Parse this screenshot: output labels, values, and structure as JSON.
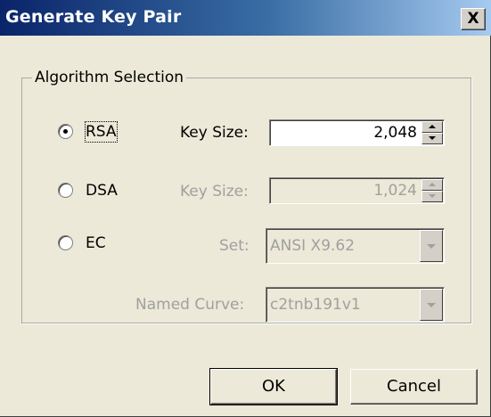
{
  "window": {
    "title": "Generate Key Pair",
    "close_glyph": "X"
  },
  "group": {
    "legend": "Algorithm Selection"
  },
  "rsa": {
    "label": "RSA",
    "selected": true,
    "key_size_label": "Key Size:",
    "key_size_value": "2,048"
  },
  "dsa": {
    "label": "DSA",
    "selected": false,
    "key_size_label": "Key Size:",
    "key_size_value": "1,024"
  },
  "ec": {
    "label": "EC",
    "selected": false,
    "set_label": "Set:",
    "set_value": "ANSI X9.62",
    "curve_label": "Named Curve:",
    "curve_value": "c2tnb191v1"
  },
  "buttons": {
    "ok": "OK",
    "cancel": "Cancel"
  },
  "colors": {
    "title_start": "#0a246a",
    "title_end": "#a6caf0",
    "dialog_bg": "#ece9d8",
    "disabled_text": "#a0a0a0"
  }
}
